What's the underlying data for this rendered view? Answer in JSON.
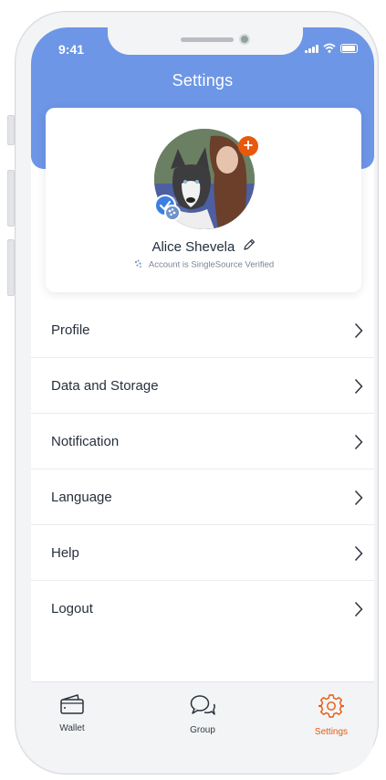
{
  "status_bar": {
    "time": "9:41"
  },
  "header": {
    "title": "Settings"
  },
  "profile": {
    "name": "Alice Shevela",
    "verification_text": "Account is SingleSource Verified"
  },
  "menu": {
    "items": [
      {
        "label": "Profile"
      },
      {
        "label": "Data and Storage"
      },
      {
        "label": "Notification"
      },
      {
        "label": "Language"
      },
      {
        "label": "Help"
      },
      {
        "label": "Logout"
      }
    ]
  },
  "tab_bar": {
    "tabs": [
      {
        "label": "Wallet",
        "icon": "wallet-icon"
      },
      {
        "label": "Group",
        "icon": "chat-bubbles-icon"
      },
      {
        "label": "Settings",
        "icon": "gear-icon",
        "active": true
      }
    ]
  },
  "colors": {
    "header": "#6d96e6",
    "accent": "#e8590c",
    "verified_blue": "#3c7fe0"
  }
}
